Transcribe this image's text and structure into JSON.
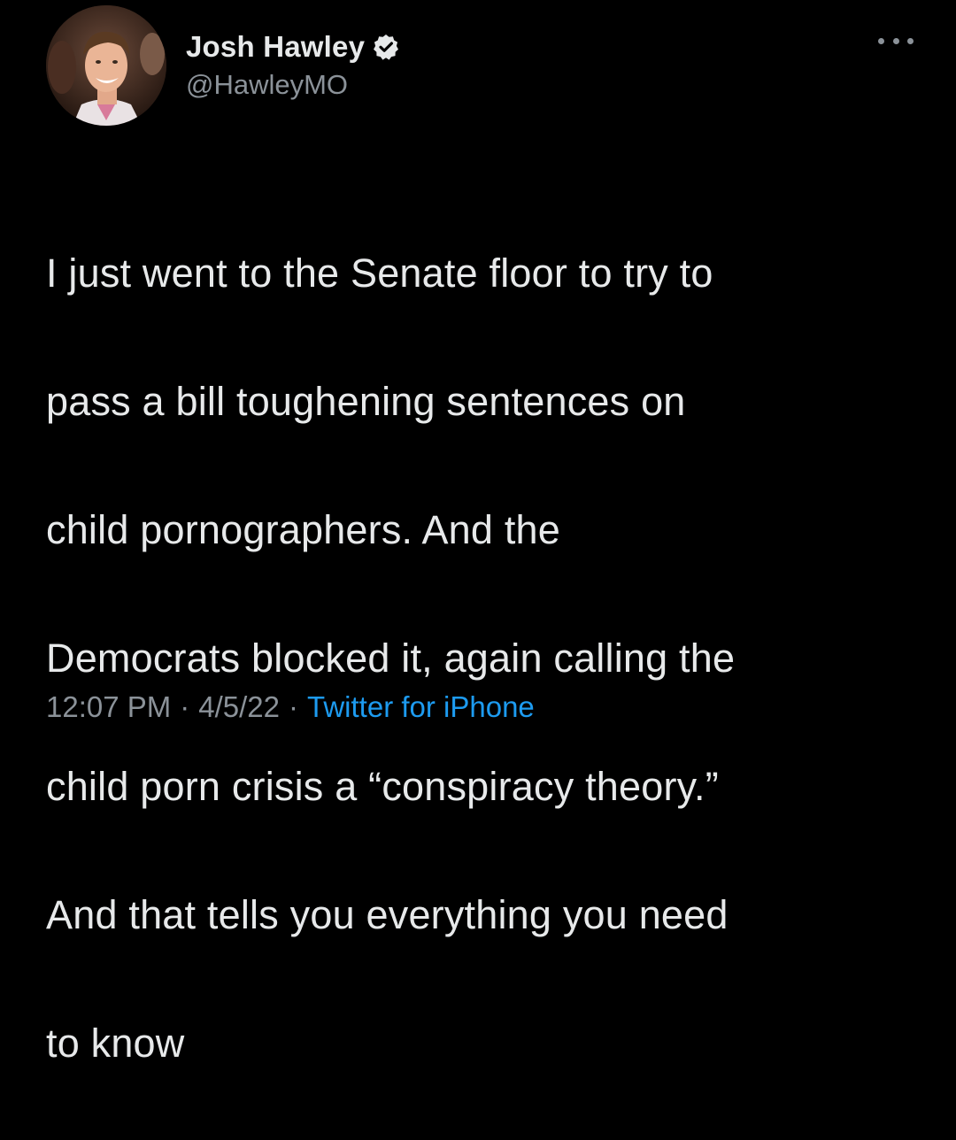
{
  "author": {
    "display_name": "Josh Hawley",
    "handle": "@HawleyMO",
    "verified": true,
    "avatar_icon": "profile-photo"
  },
  "tweet": {
    "lines": [
      "I just went to the Senate floor to try to",
      "pass a bill toughening sentences on",
      "child pornographers. And the",
      "Democrats blocked it, again calling the",
      "child porn crisis a “conspiracy theory.”",
      "And that tells you everything you need",
      "to know"
    ]
  },
  "meta": {
    "time": "12:07 PM",
    "separator": "·",
    "date": "4/5/22",
    "source": "Twitter for iPhone"
  },
  "colors": {
    "background": "#000000",
    "text": "#e7e9ea",
    "muted": "#8b9299",
    "link": "#1d9bf0",
    "verified_badge": "#e7e9ea"
  },
  "icons": {
    "verified": "verified-badge-icon",
    "more": "more-options-icon"
  }
}
